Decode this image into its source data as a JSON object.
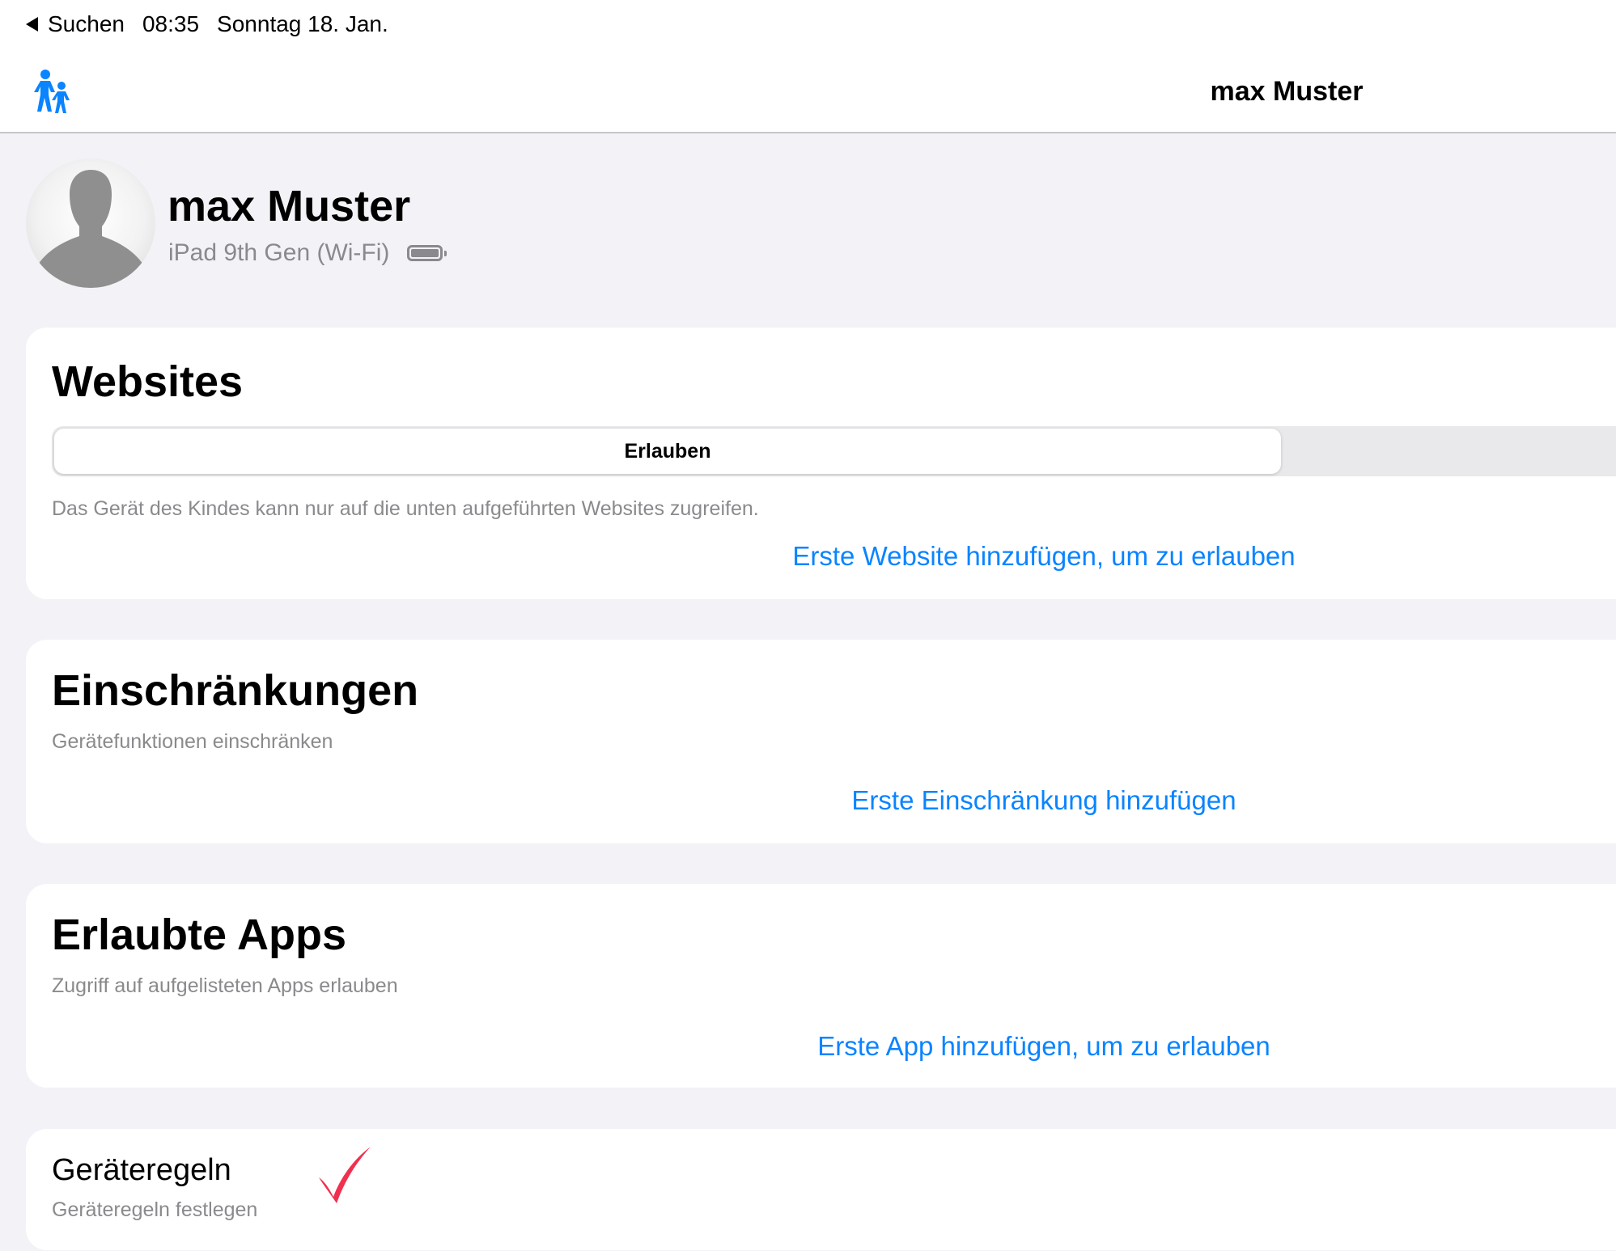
{
  "status_bar": {
    "back_label": "Suchen",
    "time": "08:35",
    "date": "Sonntag 18. Jan."
  },
  "nav": {
    "icon": "family-icon",
    "title": "max Muster"
  },
  "profile": {
    "name": "max Muster",
    "device": "iPad 9th Gen (Wi-Fi)",
    "battery_icon": "battery-icon"
  },
  "websites": {
    "title": "Websites",
    "segment_selected": "Erlauben",
    "description": "Das Gerät des Kindes kann nur auf die unten aufgeführten Websites zugreifen.",
    "action": "Erste Website hinzufügen, um zu erlauben"
  },
  "restrictions": {
    "title": "Einschränkungen",
    "subtitle": "Gerätefunktionen einschränken",
    "action": "Erste Einschränkung hinzufügen"
  },
  "allowed_apps": {
    "title": "Erlaubte Apps",
    "subtitle": "Zugriff auf aufgelisteten Apps erlauben",
    "action": "Erste App hinzufügen, um zu erlauben"
  },
  "device_rules": {
    "title": "Geräteregeln",
    "subtitle": "Geräteregeln festlegen",
    "annotation_icon": "checkmark-icon"
  },
  "colors": {
    "accent": "#0a84ff",
    "background": "#f2f2f7",
    "secondary_text": "#8a8a8e",
    "annotation": "#f0304f"
  }
}
